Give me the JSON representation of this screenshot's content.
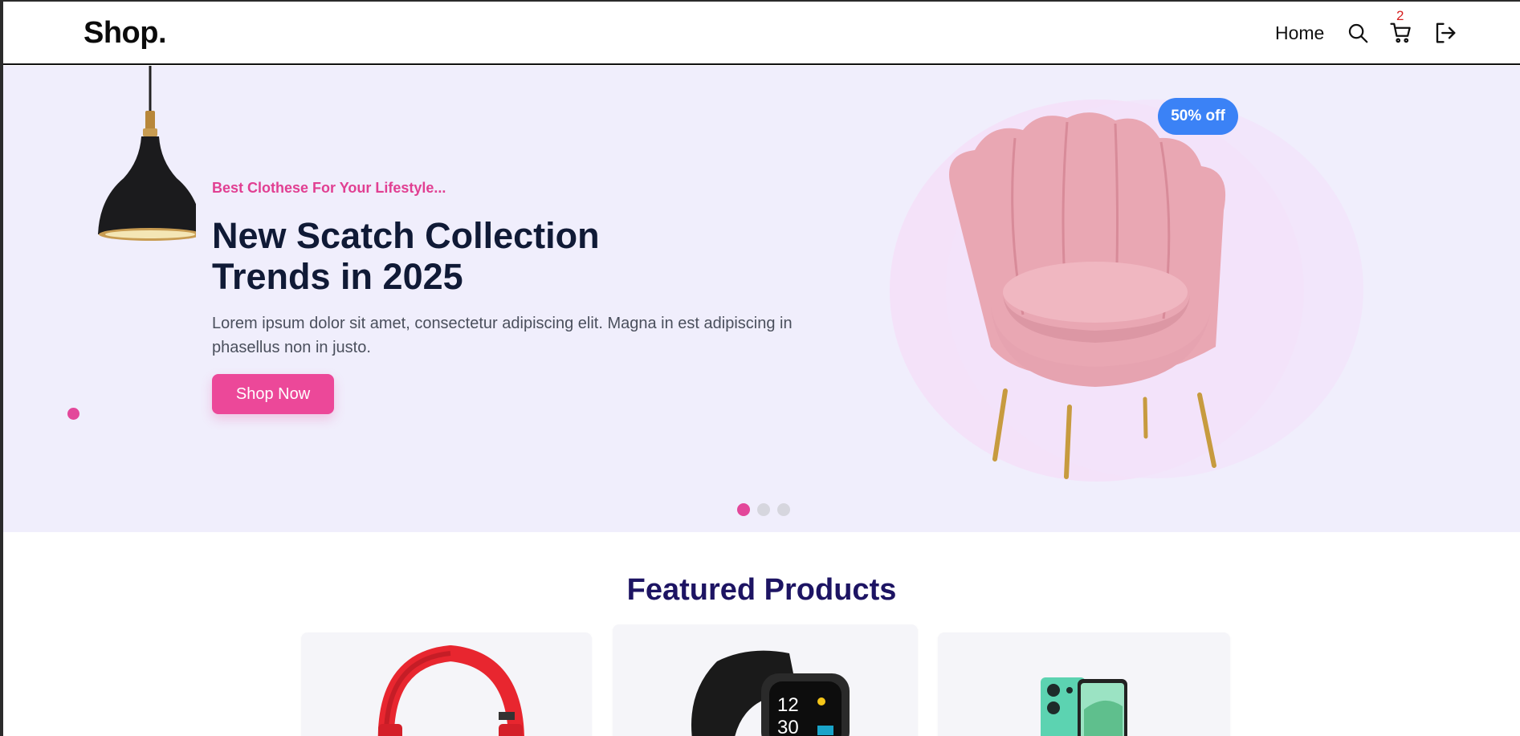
{
  "header": {
    "logo": "Shop.",
    "nav": {
      "home_label": "Home"
    },
    "icons": {
      "search": "search-icon",
      "cart": "cart-icon",
      "logout": "logout-icon"
    },
    "cart_count": "2"
  },
  "hero": {
    "tagline": "Best Clothese For Your Lifestyle...",
    "title_line1": "New Scatch Collection",
    "title_line2": "Trends in 2025",
    "description": "Lorem ipsum dolor sit amet, consectetur adipiscing elit. Magna in est adipiscing in phasellus non in justo.",
    "cta_label": "Shop Now",
    "discount_badge": "50% off",
    "slides_total": 3,
    "active_slide": 1
  },
  "featured": {
    "title": "Featured Products",
    "products": [
      {
        "image": "red-headphones"
      },
      {
        "image": "black-smartwatch"
      },
      {
        "image": "green-smartphone"
      }
    ]
  },
  "colors": {
    "accent_pink": "#ec4899",
    "badge_blue": "#3b82f6",
    "hero_bg": "#f0eefc",
    "heading_navy": "#1d1463"
  }
}
